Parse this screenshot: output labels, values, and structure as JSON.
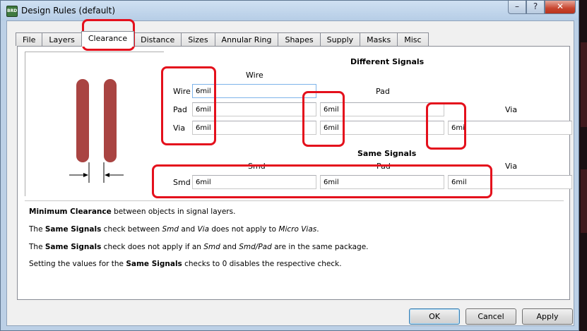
{
  "window": {
    "title": "Design Rules (default)",
    "app_icon_text": "BRD",
    "minimize_glyph": "–",
    "maximize_glyph": "?",
    "close_glyph": "✕"
  },
  "tabs": [
    {
      "label": "File",
      "active": false
    },
    {
      "label": "Layers",
      "active": false
    },
    {
      "label": "Clearance",
      "active": true
    },
    {
      "label": "Distance",
      "active": false
    },
    {
      "label": "Sizes",
      "active": false
    },
    {
      "label": "Annular Ring",
      "active": false
    },
    {
      "label": "Shapes",
      "active": false
    },
    {
      "label": "Supply",
      "active": false
    },
    {
      "label": "Masks",
      "active": false
    },
    {
      "label": "Misc",
      "active": false
    }
  ],
  "clearance": {
    "different_signals_heading": "Different Signals",
    "same_signals_heading": "Same Signals",
    "col_wire": "Wire",
    "col_pad": "Pad",
    "col_via": "Via",
    "row_wire": "Wire",
    "row_pad": "Pad",
    "row_via": "Via",
    "wire_wire": "6mil",
    "pad_wire": "6mil",
    "pad_pad": "6mil",
    "via_wire": "6mil",
    "via_pad": "6mil",
    "via_via": "6mil",
    "same_col_smd": "Smd",
    "same_col_pad": "Pad",
    "same_col_via": "Via",
    "same_row_smd": "Smd",
    "smd_smd": "6mil",
    "smd_pad": "6mil",
    "smd_via": "6mil"
  },
  "description": {
    "line1_bold": "Minimum Clearance",
    "line1_rest": " between objects in signal layers.",
    "line2_a": "The ",
    "line2_bold": "Same Signals",
    "line2_b": " check between ",
    "line2_i1": "Smd",
    "line2_c": " and ",
    "line2_i2": "Via",
    "line2_d": " does not apply to ",
    "line2_i3": "Micro Vias",
    "line2_e": ".",
    "line3_a": "The ",
    "line3_bold": "Same Signals",
    "line3_b": " check does not apply if an ",
    "line3_i1": "Smd",
    "line3_c": " and ",
    "line3_i2": "Smd/Pad",
    "line3_d": " are in the same package.",
    "line4_a": "Setting the values for the ",
    "line4_bold": "Same Signals",
    "line4_b": " checks to 0 disables the respective check."
  },
  "buttons": {
    "ok": "OK",
    "cancel": "Cancel",
    "apply": "Apply"
  },
  "colors": {
    "highlight": "#e4101c",
    "trace": "#a94442"
  }
}
